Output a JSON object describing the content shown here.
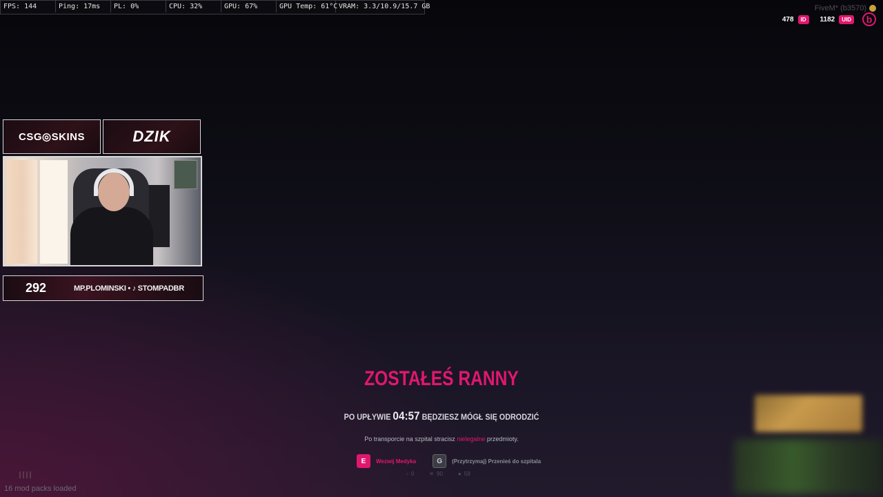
{
  "perf": [
    "FPS: 144",
    "Ping: 17ms",
    "PL: 0%",
    "CPU: 32%",
    "GPU: 67%",
    "GPU Temp: 61°C",
    "VRAM: 3.3/10.9/15.7 GB"
  ],
  "fivem": {
    "label": "FiveM* (b3570)"
  },
  "hud": {
    "id_value": "478",
    "id_label": "ID",
    "uid_value": "1182",
    "uid_label": "UID",
    "logo": "b"
  },
  "overlay": {
    "sponsor_left": "CSG◎SKINS",
    "sponsor_right": "DZIK",
    "follow_count": "292",
    "follow_text": "MP.PLOMINSKI • ♪ STOMPADBR"
  },
  "death": {
    "title": "ZOSTAŁEŚ RANNY",
    "timer_prefix": "PO UPŁYWIE",
    "timer": "04:57",
    "timer_suffix": "BĘDZIESZ MÓGŁ SIĘ ODRODZIĆ",
    "info_prefix": "Po transporcie na szpital stracisz",
    "info_highlight": "nielegalne",
    "info_suffix": "przedmioty.",
    "action_e_key": "E",
    "action_e_label": "Wezwij Medyka",
    "action_g_key": "G",
    "action_g_label": "(Przytrzymaj) Przenieś do szpitala",
    "stat1": "0",
    "stat2": "90",
    "stat3": "59"
  },
  "bottom": {
    "modpacks": "16 mod packs loaded"
  },
  "colors": {
    "accent": "#e0176f",
    "background": "#0f0e17"
  }
}
